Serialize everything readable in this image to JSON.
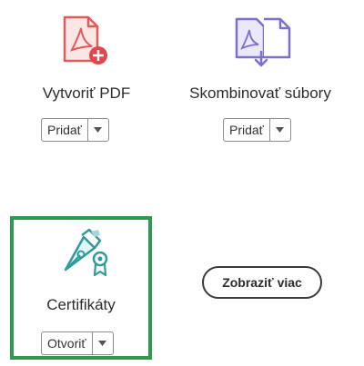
{
  "tools": [
    {
      "label": "Vytvoriť PDF",
      "button": "Pridať",
      "icon": "create-pdf-icon"
    },
    {
      "label": "Skombinovať súbory",
      "button": "Pridať",
      "icon": "combine-files-icon"
    },
    {
      "label": "Certifikáty",
      "button": "Otvoriť",
      "icon": "certificates-icon"
    }
  ],
  "more_button": "Zobraziť viac",
  "colors": {
    "create_pdf": "#e05a5a",
    "combine": "#7b6fd0",
    "certificates": "#2f9b9b",
    "highlight": "#2e9a4e"
  }
}
